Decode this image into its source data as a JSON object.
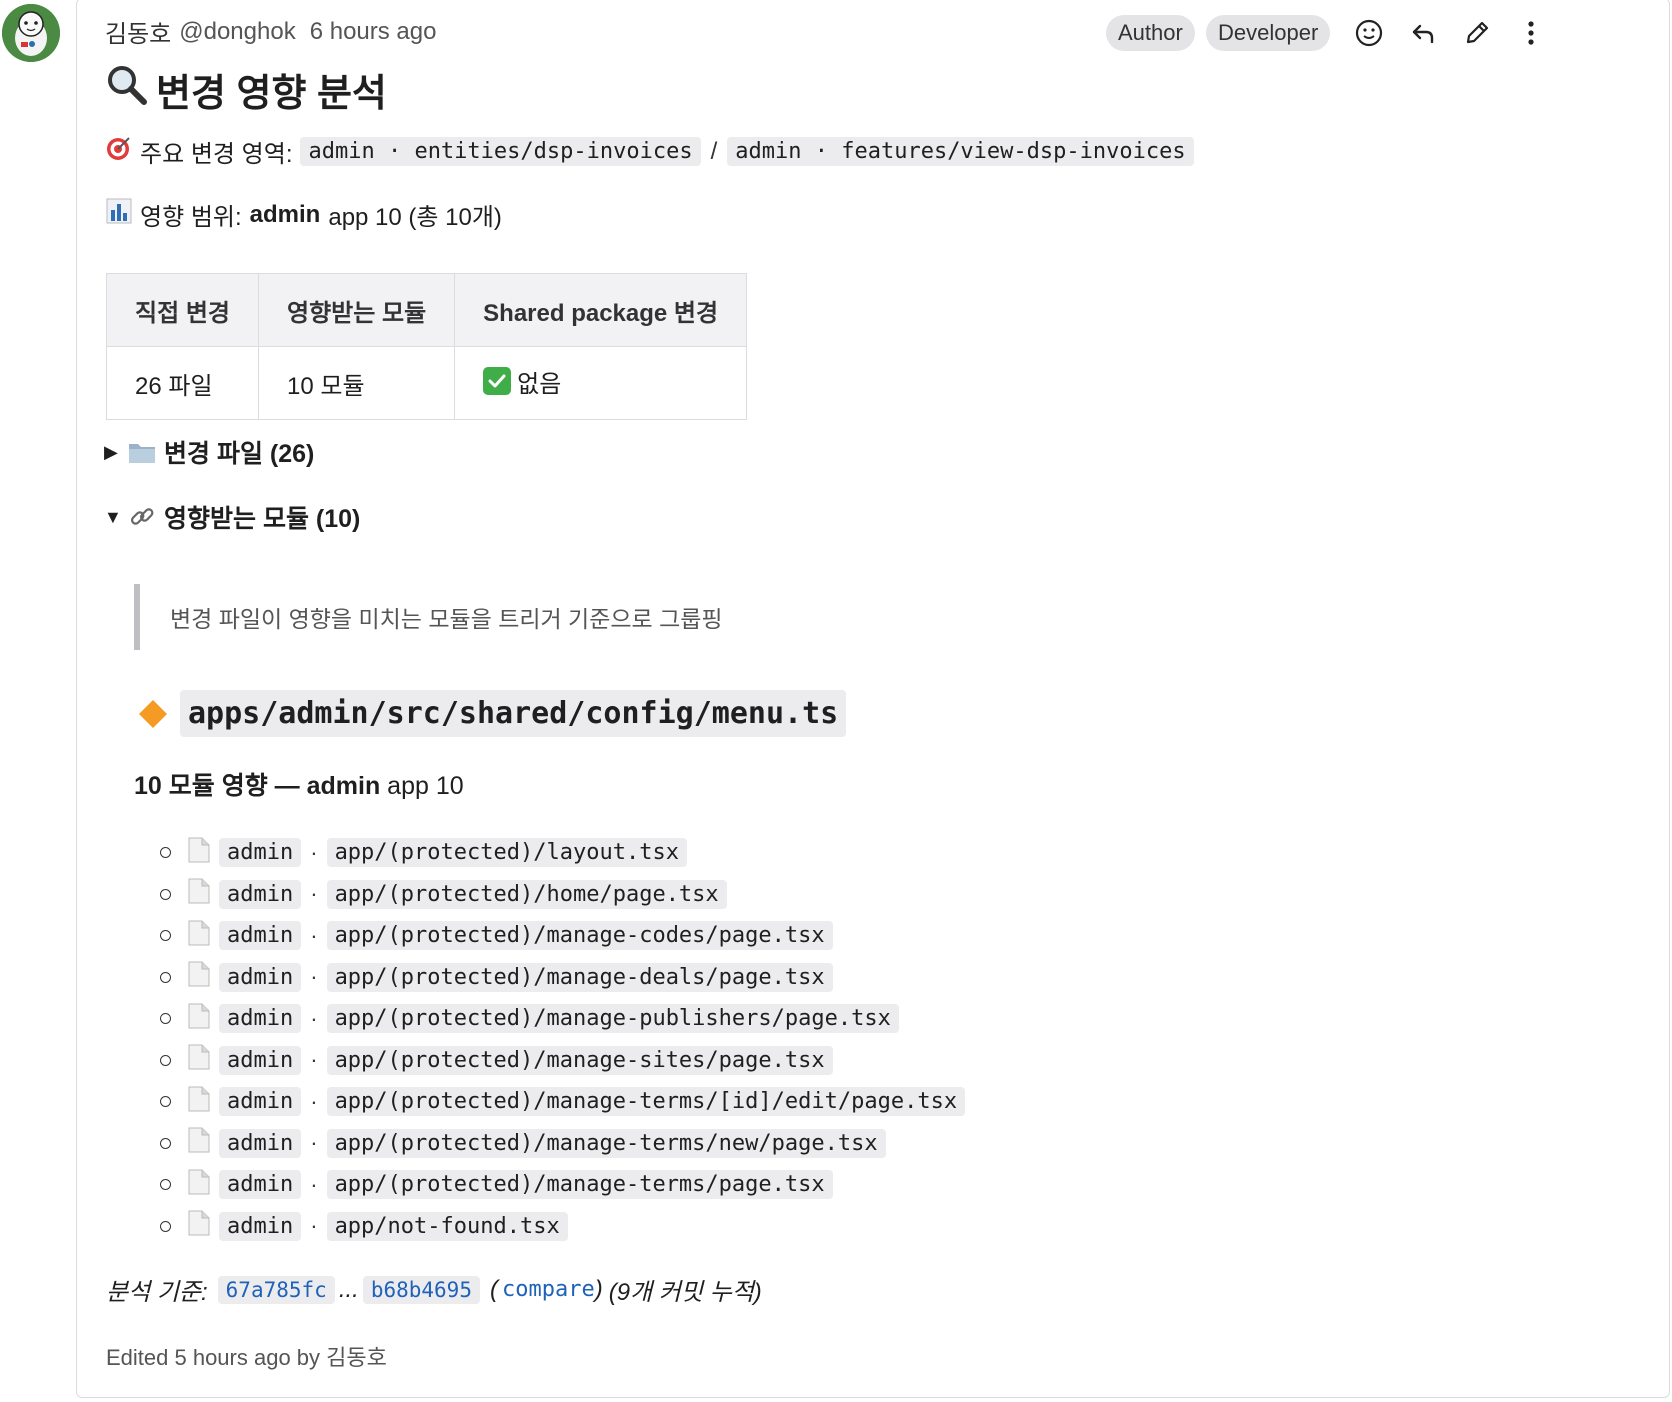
{
  "comment": {
    "author_name": "김동호",
    "author_handle": "@donghok",
    "timestamp": "6 hours ago",
    "badges": [
      "Author",
      "Developer"
    ],
    "actions": [
      "emoji-icon",
      "reply-icon",
      "edit-icon",
      "more-icon"
    ]
  },
  "title": "변경 영향 분석",
  "main_area": {
    "label": "주요 변경 영역:",
    "paths": [
      "admin · entities/dsp-invoices",
      "admin · features/view-dsp-invoices"
    ],
    "separator": "/"
  },
  "scope": {
    "label": "영향 범위:",
    "bold": "admin",
    "rest": "app 10 (총 10개)"
  },
  "summary_table": {
    "headers": [
      "직접 변경",
      "영향받는 모듈",
      "Shared package 변경"
    ],
    "row": [
      "26 파일",
      "10 모듈",
      "없음"
    ]
  },
  "changed_files": {
    "label": "변경 파일 (26)",
    "expanded": false
  },
  "affected_modules": {
    "label": "영향받는 모듈 (10)",
    "expanded": true
  },
  "blockquote": "변경 파일이 영향을 미치는 모듈을 트리거 기준으로 그룹핑",
  "trigger": {
    "path": "apps/admin/src/shared/config/menu.ts",
    "impact_bold": "10 모듈 영향 — admin",
    "impact_rest": "app 10"
  },
  "modules": [
    {
      "app": "admin",
      "path": "app/(protected)/layout.tsx"
    },
    {
      "app": "admin",
      "path": "app/(protected)/home/page.tsx"
    },
    {
      "app": "admin",
      "path": "app/(protected)/manage-codes/page.tsx"
    },
    {
      "app": "admin",
      "path": "app/(protected)/manage-deals/page.tsx"
    },
    {
      "app": "admin",
      "path": "app/(protected)/manage-publishers/page.tsx"
    },
    {
      "app": "admin",
      "path": "app/(protected)/manage-sites/page.tsx"
    },
    {
      "app": "admin",
      "path": "app/(protected)/manage-terms/[id]/edit/page.tsx"
    },
    {
      "app": "admin",
      "path": "app/(protected)/manage-terms/new/page.tsx"
    },
    {
      "app": "admin",
      "path": "app/(protected)/manage-terms/page.tsx"
    },
    {
      "app": "admin",
      "path": "app/not-found.tsx"
    }
  ],
  "basis": {
    "label": "분석 기준:",
    "from": "67a785fc",
    "dots": "...",
    "to": "b68b4695",
    "compare": "compare",
    "note": "(9개 커밋 누적)"
  },
  "edited": "Edited 5 hours ago by 김동호"
}
